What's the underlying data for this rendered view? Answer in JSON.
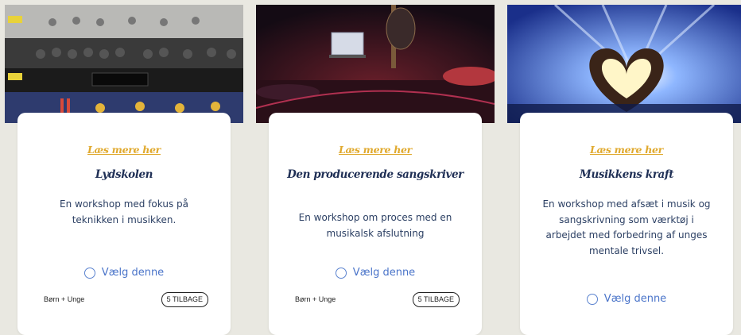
{
  "cards": [
    {
      "read_more": "Læs mere her",
      "title": "Lydskolen",
      "description": "En workshop med fokus på teknikken i musikken.",
      "select_label": "Vælg denne",
      "age_group": "Børn + Unge",
      "availability": "5 TILBAGE"
    },
    {
      "read_more": "Læs mere her",
      "title": "Den producerende sangskriver",
      "description": "En workshop om proces med en musikalsk afslutning",
      "select_label": "Vælg denne",
      "age_group": "Børn + Unge",
      "availability": "5 TILBAGE"
    },
    {
      "read_more": "Læs mere her",
      "title": "Musikkens kraft",
      "description": "En workshop med afsæt i musik og sangskrivning som værktøj i arbejdet med forbedring af unges mentale trivsel.",
      "select_label": "Vælg denne"
    }
  ],
  "images": [
    "studio-rack-equipment-photo",
    "stage-guitar-laptop-photo",
    "concert-heart-hands-photo"
  ],
  "colors": {
    "background": "#e9e8e1",
    "read_more": "#e0a92d",
    "title": "#1f2f55",
    "select": "#4a74c9"
  }
}
